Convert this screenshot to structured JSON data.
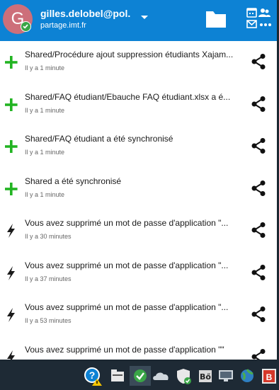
{
  "account": {
    "avatar_letter": "G",
    "name": "gilles.delobel@pol...",
    "server": "partage.imt.fr"
  },
  "activities": [
    {
      "type": "add",
      "icon": "plus-icon",
      "text": "Shared/Procédure ajout suppression étudiants Xajam...",
      "time": "Il y a 1 minute"
    },
    {
      "type": "add",
      "icon": "plus-icon",
      "text": "Shared/FAQ étudiant/Ebauche FAQ étudiant.xlsx a é...",
      "time": "Il y a 1 minute"
    },
    {
      "type": "add",
      "icon": "plus-icon",
      "text": "Shared/FAQ étudiant a été synchronisé",
      "time": "Il y a 1 minute"
    },
    {
      "type": "add",
      "icon": "plus-icon",
      "text": "Shared a été synchronisé",
      "time": "Il y a 1 minute"
    },
    {
      "type": "bolt",
      "icon": "lightning-icon",
      "text": "Vous avez supprimé un mot de passe d'application \"...",
      "time": "Il y a 30 minutes"
    },
    {
      "type": "bolt",
      "icon": "lightning-icon",
      "text": "Vous avez supprimé un mot de passe d'application \"...",
      "time": "Il y a 37 minutes"
    },
    {
      "type": "bolt",
      "icon": "lightning-icon",
      "text": "Vous avez supprimé un mot de passe d'application \"...",
      "time": "Il y a 53 minutes"
    },
    {
      "type": "bolt",
      "icon": "lightning-icon",
      "text": "Vous avez supprimé un mot de passe d'application \"\"",
      "time": ""
    }
  ],
  "colors": {
    "header": "#0d82d4",
    "add": "#22b422",
    "bolt": "#1a1a1a",
    "taskbar": "#1e2a35"
  },
  "tray_icons": [
    "help-warning-icon",
    "folder-share-icon",
    "nextcloud-check-icon",
    "onedrive-cloud-icon",
    "defender-shield-icon",
    "bitlocker-icon",
    "display-icon",
    "globe-icon",
    "app-red-icon"
  ]
}
